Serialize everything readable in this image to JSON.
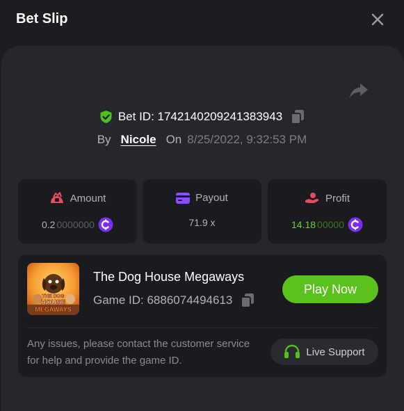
{
  "header": {
    "title": "Bet Slip",
    "close_icon": "close-icon"
  },
  "bet": {
    "bet_id_label": "Bet ID: 1742140209241383943",
    "by_label": "By",
    "username": "Nicole",
    "on_label": "On",
    "date": "8/25/2022, 9:32:53 PM"
  },
  "stats": {
    "amount": {
      "label": "Amount",
      "value_bright": "0.2",
      "value_dim": "0000000",
      "icon": "coin-icon"
    },
    "payout": {
      "label": "Payout",
      "value": "71.9 x"
    },
    "profit": {
      "label": "Profit",
      "value_bright": "14.18",
      "value_dim": "00000",
      "icon": "coin-icon"
    }
  },
  "game": {
    "name": "The Dog House Megaways",
    "game_id_label": "Game ID: 6886074494613",
    "play_label": "Play Now",
    "thumb_line1": "THE DOG",
    "thumb_line2": "HOUSE",
    "thumb_line3": "MEGAWAYS"
  },
  "support": {
    "help_text": "Any issues, please contact the customer service for help and provide the game ID.",
    "button_label": "Live Support"
  },
  "colors": {
    "accent_green": "#5bc21d",
    "profit_green": "#6dd31f",
    "coin_purple": "#7a2ff0",
    "amount_red": "#e84a5f",
    "payout_purple": "#8a4dff"
  }
}
